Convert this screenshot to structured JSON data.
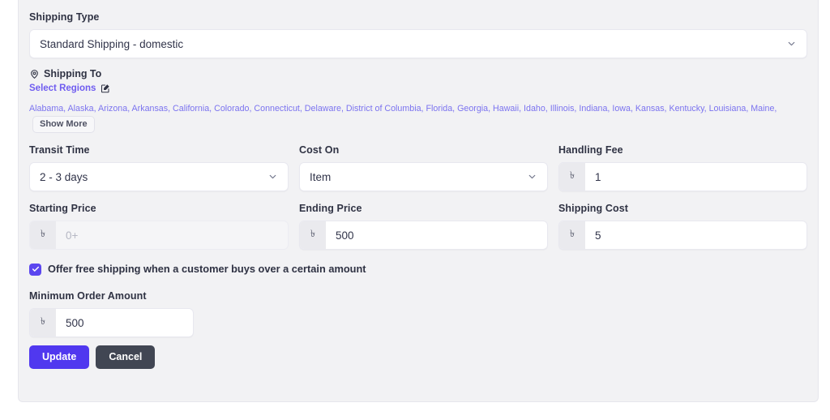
{
  "theme": {
    "panel_bg": "#f2f2f4",
    "accent": "#5038ef",
    "link": "#7b73ef",
    "cancel_bg": "#414653",
    "text": "#2f3243"
  },
  "shipping_type": {
    "label": "Shipping Type",
    "value": "Standard Shipping - domestic",
    "chevron_icon": "chevron-down-icon"
  },
  "shipping_to": {
    "pin_icon": "location-pin-icon",
    "title": "Shipping To",
    "select_regions_label": "Select Regions",
    "edit_icon": "edit-square-icon",
    "regions_text": "Alabama, Alaska, Arizona, Arkansas, California, Colorado, Connecticut, Delaware, District of Columbia, Florida, Georgia, Hawaii, Idaho, Illinois, Indiana, Iowa, Kansas, Kentucky, Louisiana, Maine,",
    "show_more_label": "Show More"
  },
  "fields": {
    "transit_time": {
      "label": "Transit Time",
      "value": "2 - 3 days",
      "chevron_icon": "chevron-down-icon"
    },
    "cost_on": {
      "label": "Cost On",
      "value": "Item",
      "chevron_icon": "chevron-down-icon"
    },
    "handling_fee": {
      "label": "Handling Fee",
      "currency": "৳",
      "value": "1",
      "placeholder": ""
    },
    "starting_price": {
      "label": "Starting Price",
      "currency": "৳",
      "value": "",
      "placeholder": "0+"
    },
    "ending_price": {
      "label": "Ending Price",
      "currency": "৳",
      "value": "500",
      "placeholder": ""
    },
    "shipping_cost": {
      "label": "Shipping Cost",
      "currency": "৳",
      "value": "5",
      "placeholder": ""
    },
    "minimum_order_amount": {
      "label": "Minimum Order Amount",
      "currency": "৳",
      "value": "500",
      "placeholder": ""
    }
  },
  "free_shipping": {
    "checked": true,
    "check_icon": "checkmark-icon",
    "label": "Offer free shipping when a customer buys over a certain amount"
  },
  "actions": {
    "update_label": "Update",
    "cancel_label": "Cancel"
  }
}
